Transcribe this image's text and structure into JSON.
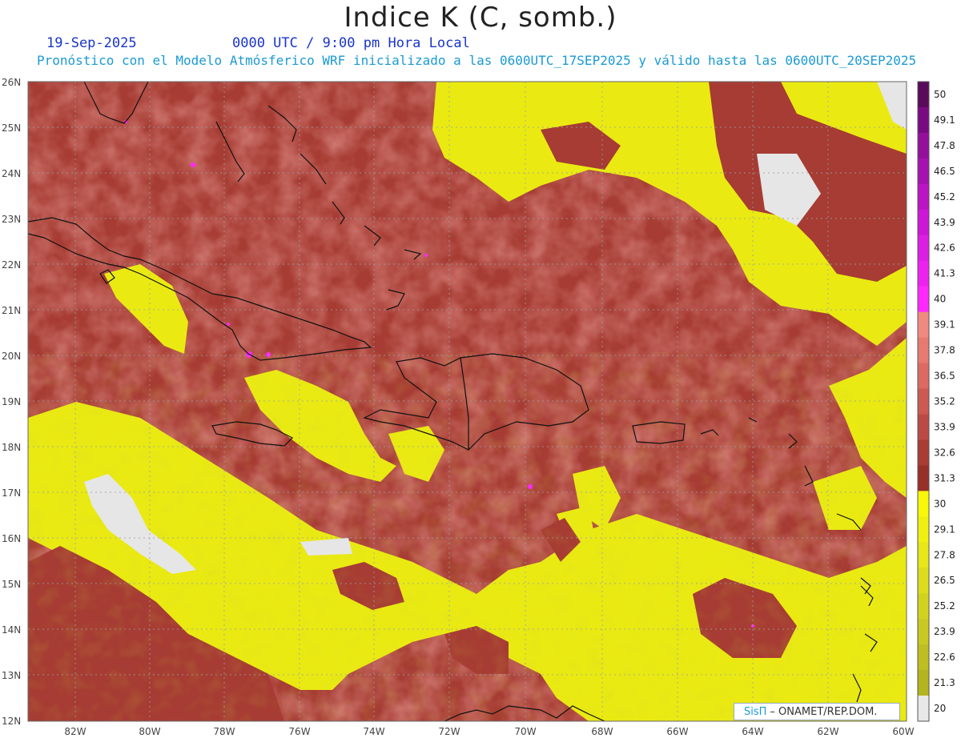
{
  "header": {
    "title": "Indice K (C, somb.)",
    "date": "19-Sep-2025",
    "time": "0000 UTC / 9:00 pm Hora Local",
    "model_line": "Pronóstico con el Modelo Atmósferico WRF inicializado a las 0600UTC_17SEP2025 y válido hasta las  0600UTC_20SEP2025"
  },
  "axes": {
    "lat_labels": [
      "26N",
      "25N",
      "24N",
      "23N",
      "22N",
      "21N",
      "20N",
      "19N",
      "18N",
      "17N",
      "16N",
      "15N",
      "14N",
      "13N",
      "12N"
    ],
    "lon_labels": [
      "82W",
      "80W",
      "78W",
      "76W",
      "74W",
      "72W",
      "70W",
      "68W",
      "66W",
      "64W",
      "62W",
      "60W"
    ]
  },
  "colorbar": {
    "labels": [
      "50",
      "49.1",
      "47.8",
      "46.5",
      "45.2",
      "43.9",
      "42.6",
      "41.3",
      "40",
      "39.1",
      "37.8",
      "36.5",
      "35.2",
      "33.9",
      "32.6",
      "31.3",
      "30",
      "29.1",
      "27.8",
      "26.5",
      "25.2",
      "23.9",
      "22.6",
      "21.3",
      "20"
    ],
    "colors": [
      "#5a0a5a",
      "#7a0a82",
      "#94109c",
      "#a612b0",
      "#ba14c4",
      "#cc18d6",
      "#dc1ee4",
      "#ee22f0",
      "#ff28ff",
      "#f08a80",
      "#e67a70",
      "#dc6a62",
      "#cc5a52",
      "#bc4a44",
      "#aa3c36",
      "#963028",
      "#f8f808",
      "#f0f010",
      "#e6e618",
      "#dcdc1c",
      "#d2d21e",
      "#c8c820",
      "#bebe20",
      "#b4b41e",
      "#e8e8e8"
    ]
  },
  "colors": {
    "k_high": "#c4504a",
    "k_mid": "#a83e34",
    "k_low": "#eaea12",
    "no_data": "#e6e6e6",
    "coast": "#111111"
  },
  "credit": {
    "brand": "SisΠ",
    "org": "– ONAMET/REP.DOM."
  }
}
